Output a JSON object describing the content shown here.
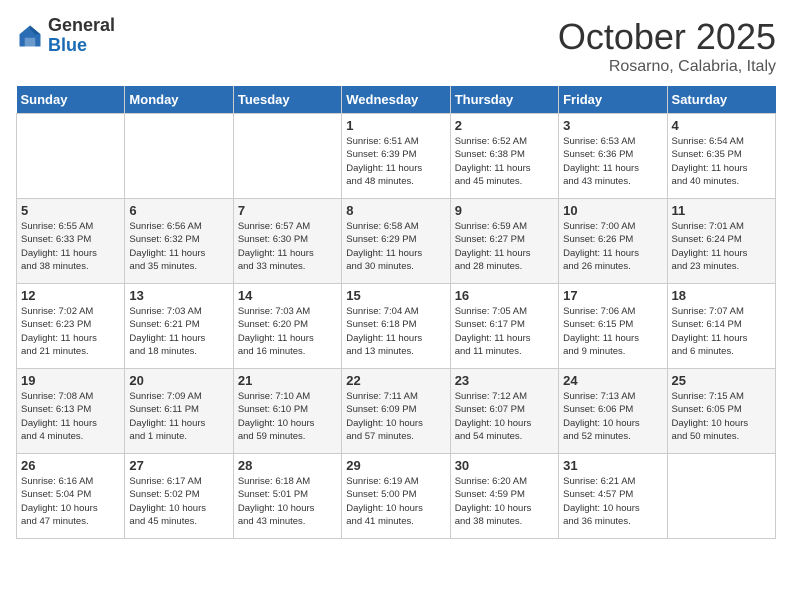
{
  "header": {
    "logo": {
      "general": "General",
      "blue": "Blue",
      "tagline": ""
    },
    "title": "October 2025",
    "subtitle": "Rosarno, Calabria, Italy"
  },
  "columns": [
    "Sunday",
    "Monday",
    "Tuesday",
    "Wednesday",
    "Thursday",
    "Friday",
    "Saturday"
  ],
  "weeks": [
    [
      {
        "day": "",
        "info": ""
      },
      {
        "day": "",
        "info": ""
      },
      {
        "day": "",
        "info": ""
      },
      {
        "day": "1",
        "info": "Sunrise: 6:51 AM\nSunset: 6:39 PM\nDaylight: 11 hours\nand 48 minutes."
      },
      {
        "day": "2",
        "info": "Sunrise: 6:52 AM\nSunset: 6:38 PM\nDaylight: 11 hours\nand 45 minutes."
      },
      {
        "day": "3",
        "info": "Sunrise: 6:53 AM\nSunset: 6:36 PM\nDaylight: 11 hours\nand 43 minutes."
      },
      {
        "day": "4",
        "info": "Sunrise: 6:54 AM\nSunset: 6:35 PM\nDaylight: 11 hours\nand 40 minutes."
      }
    ],
    [
      {
        "day": "5",
        "info": "Sunrise: 6:55 AM\nSunset: 6:33 PM\nDaylight: 11 hours\nand 38 minutes."
      },
      {
        "day": "6",
        "info": "Sunrise: 6:56 AM\nSunset: 6:32 PM\nDaylight: 11 hours\nand 35 minutes."
      },
      {
        "day": "7",
        "info": "Sunrise: 6:57 AM\nSunset: 6:30 PM\nDaylight: 11 hours\nand 33 minutes."
      },
      {
        "day": "8",
        "info": "Sunrise: 6:58 AM\nSunset: 6:29 PM\nDaylight: 11 hours\nand 30 minutes."
      },
      {
        "day": "9",
        "info": "Sunrise: 6:59 AM\nSunset: 6:27 PM\nDaylight: 11 hours\nand 28 minutes."
      },
      {
        "day": "10",
        "info": "Sunrise: 7:00 AM\nSunset: 6:26 PM\nDaylight: 11 hours\nand 26 minutes."
      },
      {
        "day": "11",
        "info": "Sunrise: 7:01 AM\nSunset: 6:24 PM\nDaylight: 11 hours\nand 23 minutes."
      }
    ],
    [
      {
        "day": "12",
        "info": "Sunrise: 7:02 AM\nSunset: 6:23 PM\nDaylight: 11 hours\nand 21 minutes."
      },
      {
        "day": "13",
        "info": "Sunrise: 7:03 AM\nSunset: 6:21 PM\nDaylight: 11 hours\nand 18 minutes."
      },
      {
        "day": "14",
        "info": "Sunrise: 7:03 AM\nSunset: 6:20 PM\nDaylight: 11 hours\nand 16 minutes."
      },
      {
        "day": "15",
        "info": "Sunrise: 7:04 AM\nSunset: 6:18 PM\nDaylight: 11 hours\nand 13 minutes."
      },
      {
        "day": "16",
        "info": "Sunrise: 7:05 AM\nSunset: 6:17 PM\nDaylight: 11 hours\nand 11 minutes."
      },
      {
        "day": "17",
        "info": "Sunrise: 7:06 AM\nSunset: 6:15 PM\nDaylight: 11 hours\nand 9 minutes."
      },
      {
        "day": "18",
        "info": "Sunrise: 7:07 AM\nSunset: 6:14 PM\nDaylight: 11 hours\nand 6 minutes."
      }
    ],
    [
      {
        "day": "19",
        "info": "Sunrise: 7:08 AM\nSunset: 6:13 PM\nDaylight: 11 hours\nand 4 minutes."
      },
      {
        "day": "20",
        "info": "Sunrise: 7:09 AM\nSunset: 6:11 PM\nDaylight: 11 hours\nand 1 minute."
      },
      {
        "day": "21",
        "info": "Sunrise: 7:10 AM\nSunset: 6:10 PM\nDaylight: 10 hours\nand 59 minutes."
      },
      {
        "day": "22",
        "info": "Sunrise: 7:11 AM\nSunset: 6:09 PM\nDaylight: 10 hours\nand 57 minutes."
      },
      {
        "day": "23",
        "info": "Sunrise: 7:12 AM\nSunset: 6:07 PM\nDaylight: 10 hours\nand 54 minutes."
      },
      {
        "day": "24",
        "info": "Sunrise: 7:13 AM\nSunset: 6:06 PM\nDaylight: 10 hours\nand 52 minutes."
      },
      {
        "day": "25",
        "info": "Sunrise: 7:15 AM\nSunset: 6:05 PM\nDaylight: 10 hours\nand 50 minutes."
      }
    ],
    [
      {
        "day": "26",
        "info": "Sunrise: 6:16 AM\nSunset: 5:04 PM\nDaylight: 10 hours\nand 47 minutes."
      },
      {
        "day": "27",
        "info": "Sunrise: 6:17 AM\nSunset: 5:02 PM\nDaylight: 10 hours\nand 45 minutes."
      },
      {
        "day": "28",
        "info": "Sunrise: 6:18 AM\nSunset: 5:01 PM\nDaylight: 10 hours\nand 43 minutes."
      },
      {
        "day": "29",
        "info": "Sunrise: 6:19 AM\nSunset: 5:00 PM\nDaylight: 10 hours\nand 41 minutes."
      },
      {
        "day": "30",
        "info": "Sunrise: 6:20 AM\nSunset: 4:59 PM\nDaylight: 10 hours\nand 38 minutes."
      },
      {
        "day": "31",
        "info": "Sunrise: 6:21 AM\nSunset: 4:57 PM\nDaylight: 10 hours\nand 36 minutes."
      },
      {
        "day": "",
        "info": ""
      }
    ]
  ]
}
